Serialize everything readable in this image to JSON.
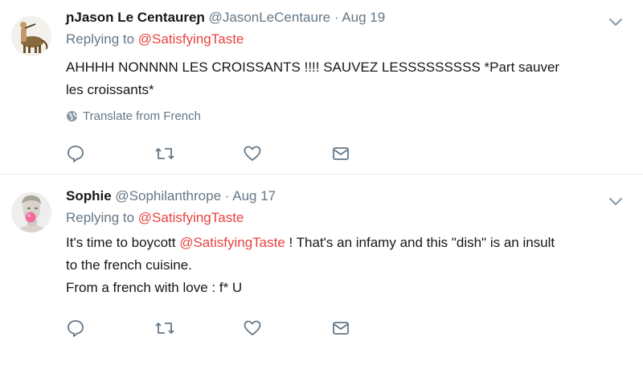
{
  "tweets": [
    {
      "name": "ɲJason Le Centaureɲ",
      "handle": "@JasonLeCentaure",
      "date": "Aug 19",
      "replying_prefix": "Replying to",
      "replying_to": "@SatisfyingTaste",
      "text_lines": [
        "AHHHH NONNNN LES CROISSANTS !!!! SAUVEZ LESSSSSSSSS *Part sauver",
        "les croissants*"
      ],
      "translate_label": "Translate from French",
      "avatar_icon": "centaur-avatar-icon"
    },
    {
      "name": "Sophie",
      "handle": "@Sophilanthrope",
      "date": "Aug 17",
      "replying_prefix": "Replying to",
      "replying_to": "@SatisfyingTaste",
      "text_pre": "It's time to boycott ",
      "text_mention": "@SatisfyingTaste",
      "text_post": " ! That's an infamy and this \"dish\" is an insult",
      "text_line2": "to the french cuisine.",
      "text_line3": "From a french with love : f* U",
      "avatar_icon": "statue-bubblegum-avatar-icon"
    }
  ],
  "separator": "·",
  "icons": [
    "reply-icon",
    "retweet-icon",
    "like-icon",
    "message-icon",
    "chevron-down-icon",
    "globe-icon"
  ],
  "colors": {
    "mention": "#e8423f",
    "muted": "#657786",
    "text": "#14171a"
  }
}
